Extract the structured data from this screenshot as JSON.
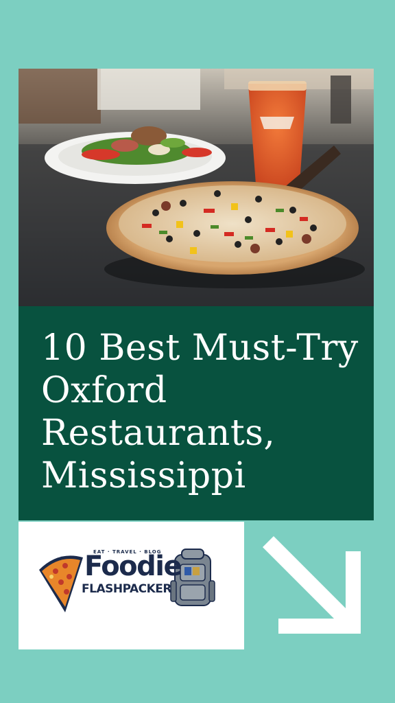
{
  "pin": {
    "title": "10 Best Must-Try Oxford Restaurants, Mississippi",
    "hero_image": "pizza-salad-beer-photo",
    "colors": {
      "background": "#7ccfc1",
      "title_panel": "#08523f",
      "title_text": "#ffffff",
      "arrow": "#ffffff"
    }
  },
  "logo": {
    "tagline": "EAT · TRAVEL · BLOG",
    "brand_top": "Foodie",
    "brand_bottom": "FLASHPACKER",
    "colors": {
      "navy": "#1c2b4c",
      "pizza": "#e8862a",
      "backpack": "#7a8590"
    }
  },
  "icons": {
    "arrow": "arrow-down-right-icon",
    "pizza": "pizza-slice-icon",
    "backpack": "backpack-icon"
  }
}
